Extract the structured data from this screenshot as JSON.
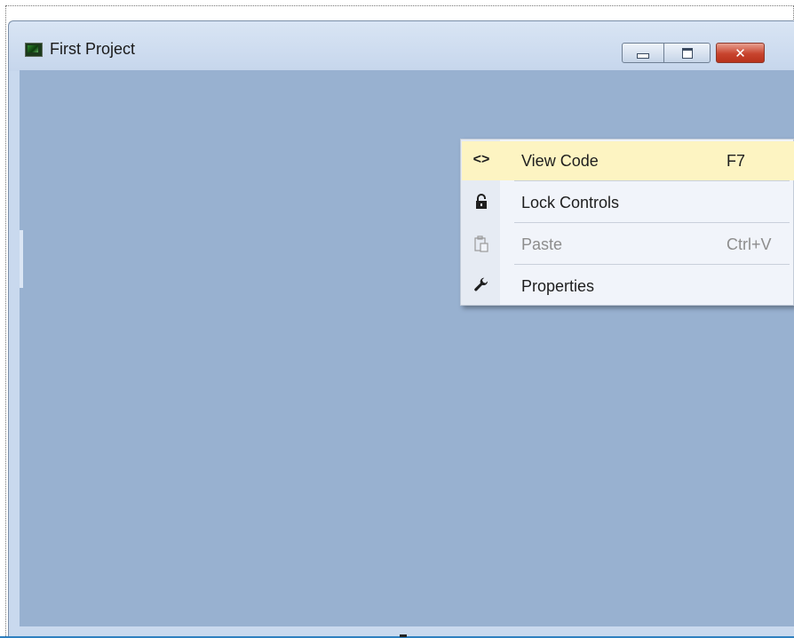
{
  "window": {
    "title": "First Project",
    "icon": "form-app-icon",
    "caption_buttons": [
      {
        "name": "minimize",
        "glyph": "minimize-icon"
      },
      {
        "name": "maximize",
        "glyph": "maximize-icon"
      },
      {
        "name": "close",
        "glyph": "close-icon",
        "symbol": "✕"
      }
    ]
  },
  "context_menu": {
    "items": [
      {
        "icon": "view-code-icon",
        "icon_glyph": "<>",
        "label": "View Code",
        "shortcut": "F7",
        "disabled": false,
        "highlighted": true
      },
      {
        "icon": "lock-icon",
        "icon_glyph": "",
        "label": "Lock Controls",
        "shortcut": "",
        "disabled": false,
        "highlighted": false
      },
      {
        "icon": "paste-icon",
        "icon_glyph": "",
        "label": "Paste",
        "shortcut": "Ctrl+V",
        "disabled": true,
        "highlighted": false
      },
      {
        "icon": "wrench-icon",
        "icon_glyph": "",
        "label": "Properties",
        "shortcut": "",
        "disabled": false,
        "highlighted": false
      }
    ]
  },
  "colors": {
    "client_area": "#98b1d0",
    "menu_highlight": "#fdf4c2",
    "menu_background": "#f1f4fa",
    "close_button": "#c8442e"
  }
}
